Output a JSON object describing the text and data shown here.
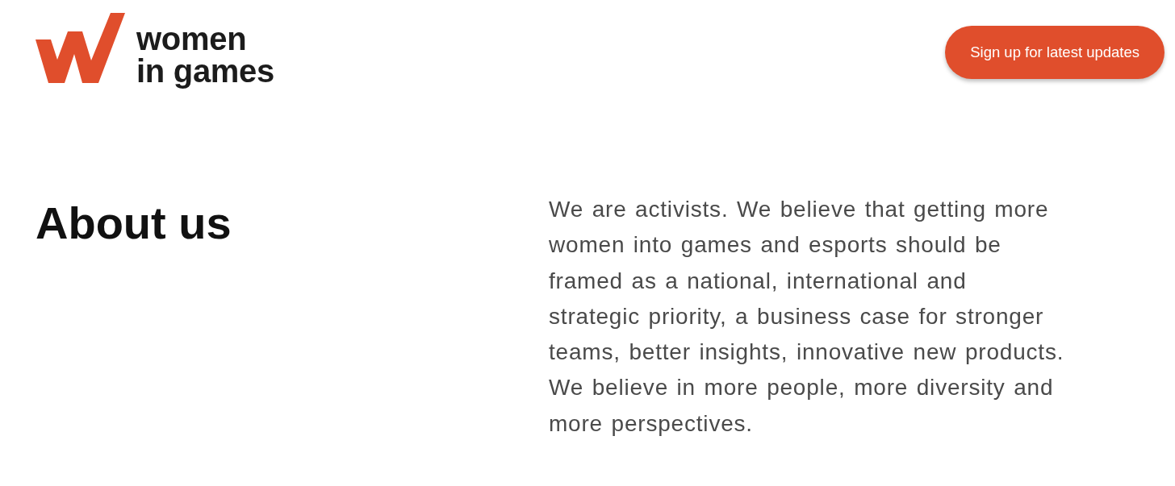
{
  "header": {
    "logo": {
      "wordmark_lines": [
        "women",
        "in games"
      ]
    },
    "signup_button": {
      "label": "Sign up for latest updates"
    }
  },
  "about": {
    "heading": "About us",
    "body": "We are activists. We believe that getting more women into games and esports should be framed as a national, international and strategic priority, a business case for stronger teams, better insights, innovative new products. We believe in more people, more diversity and more perspectives."
  }
}
